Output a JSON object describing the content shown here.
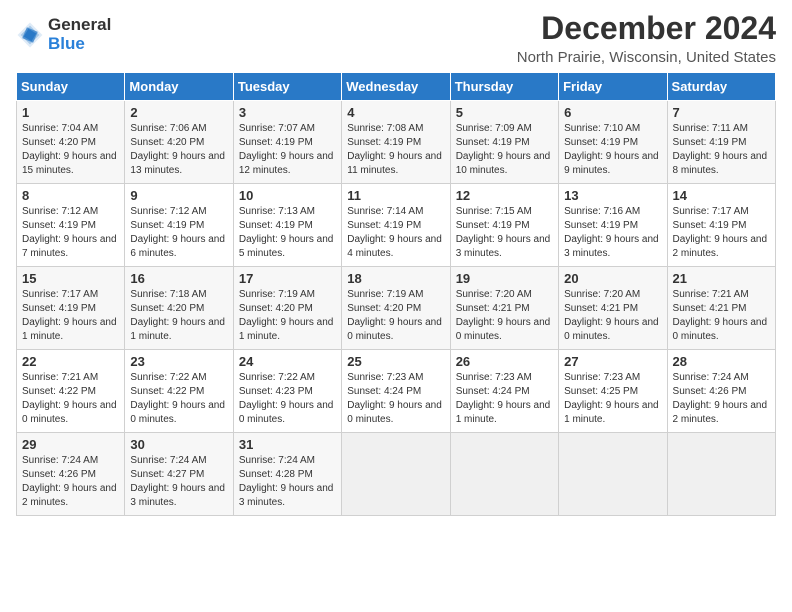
{
  "header": {
    "logo_general": "General",
    "logo_blue": "Blue",
    "month_title": "December 2024",
    "location": "North Prairie, Wisconsin, United States"
  },
  "weekdays": [
    "Sunday",
    "Monday",
    "Tuesday",
    "Wednesday",
    "Thursday",
    "Friday",
    "Saturday"
  ],
  "weeks": [
    [
      {
        "day": "1",
        "sunrise": "7:04 AM",
        "sunset": "4:20 PM",
        "daylight": "9 hours and 15 minutes."
      },
      {
        "day": "2",
        "sunrise": "7:06 AM",
        "sunset": "4:20 PM",
        "daylight": "9 hours and 13 minutes."
      },
      {
        "day": "3",
        "sunrise": "7:07 AM",
        "sunset": "4:19 PM",
        "daylight": "9 hours and 12 minutes."
      },
      {
        "day": "4",
        "sunrise": "7:08 AM",
        "sunset": "4:19 PM",
        "daylight": "9 hours and 11 minutes."
      },
      {
        "day": "5",
        "sunrise": "7:09 AM",
        "sunset": "4:19 PM",
        "daylight": "9 hours and 10 minutes."
      },
      {
        "day": "6",
        "sunrise": "7:10 AM",
        "sunset": "4:19 PM",
        "daylight": "9 hours and 9 minutes."
      },
      {
        "day": "7",
        "sunrise": "7:11 AM",
        "sunset": "4:19 PM",
        "daylight": "9 hours and 8 minutes."
      }
    ],
    [
      {
        "day": "8",
        "sunrise": "7:12 AM",
        "sunset": "4:19 PM",
        "daylight": "9 hours and 7 minutes."
      },
      {
        "day": "9",
        "sunrise": "7:12 AM",
        "sunset": "4:19 PM",
        "daylight": "9 hours and 6 minutes."
      },
      {
        "day": "10",
        "sunrise": "7:13 AM",
        "sunset": "4:19 PM",
        "daylight": "9 hours and 5 minutes."
      },
      {
        "day": "11",
        "sunrise": "7:14 AM",
        "sunset": "4:19 PM",
        "daylight": "9 hours and 4 minutes."
      },
      {
        "day": "12",
        "sunrise": "7:15 AM",
        "sunset": "4:19 PM",
        "daylight": "9 hours and 3 minutes."
      },
      {
        "day": "13",
        "sunrise": "7:16 AM",
        "sunset": "4:19 PM",
        "daylight": "9 hours and 3 minutes."
      },
      {
        "day": "14",
        "sunrise": "7:17 AM",
        "sunset": "4:19 PM",
        "daylight": "9 hours and 2 minutes."
      }
    ],
    [
      {
        "day": "15",
        "sunrise": "7:17 AM",
        "sunset": "4:19 PM",
        "daylight": "9 hours and 1 minute."
      },
      {
        "day": "16",
        "sunrise": "7:18 AM",
        "sunset": "4:20 PM",
        "daylight": "9 hours and 1 minute."
      },
      {
        "day": "17",
        "sunrise": "7:19 AM",
        "sunset": "4:20 PM",
        "daylight": "9 hours and 1 minute."
      },
      {
        "day": "18",
        "sunrise": "7:19 AM",
        "sunset": "4:20 PM",
        "daylight": "9 hours and 0 minutes."
      },
      {
        "day": "19",
        "sunrise": "7:20 AM",
        "sunset": "4:21 PM",
        "daylight": "9 hours and 0 minutes."
      },
      {
        "day": "20",
        "sunrise": "7:20 AM",
        "sunset": "4:21 PM",
        "daylight": "9 hours and 0 minutes."
      },
      {
        "day": "21",
        "sunrise": "7:21 AM",
        "sunset": "4:21 PM",
        "daylight": "9 hours and 0 minutes."
      }
    ],
    [
      {
        "day": "22",
        "sunrise": "7:21 AM",
        "sunset": "4:22 PM",
        "daylight": "9 hours and 0 minutes."
      },
      {
        "day": "23",
        "sunrise": "7:22 AM",
        "sunset": "4:22 PM",
        "daylight": "9 hours and 0 minutes."
      },
      {
        "day": "24",
        "sunrise": "7:22 AM",
        "sunset": "4:23 PM",
        "daylight": "9 hours and 0 minutes."
      },
      {
        "day": "25",
        "sunrise": "7:23 AM",
        "sunset": "4:24 PM",
        "daylight": "9 hours and 0 minutes."
      },
      {
        "day": "26",
        "sunrise": "7:23 AM",
        "sunset": "4:24 PM",
        "daylight": "9 hours and 1 minute."
      },
      {
        "day": "27",
        "sunrise": "7:23 AM",
        "sunset": "4:25 PM",
        "daylight": "9 hours and 1 minute."
      },
      {
        "day": "28",
        "sunrise": "7:24 AM",
        "sunset": "4:26 PM",
        "daylight": "9 hours and 2 minutes."
      }
    ],
    [
      {
        "day": "29",
        "sunrise": "7:24 AM",
        "sunset": "4:26 PM",
        "daylight": "9 hours and 2 minutes."
      },
      {
        "day": "30",
        "sunrise": "7:24 AM",
        "sunset": "4:27 PM",
        "daylight": "9 hours and 3 minutes."
      },
      {
        "day": "31",
        "sunrise": "7:24 AM",
        "sunset": "4:28 PM",
        "daylight": "9 hours and 3 minutes."
      },
      null,
      null,
      null,
      null
    ]
  ],
  "labels": {
    "sunrise": "Sunrise:",
    "sunset": "Sunset:",
    "daylight": "Daylight:"
  }
}
